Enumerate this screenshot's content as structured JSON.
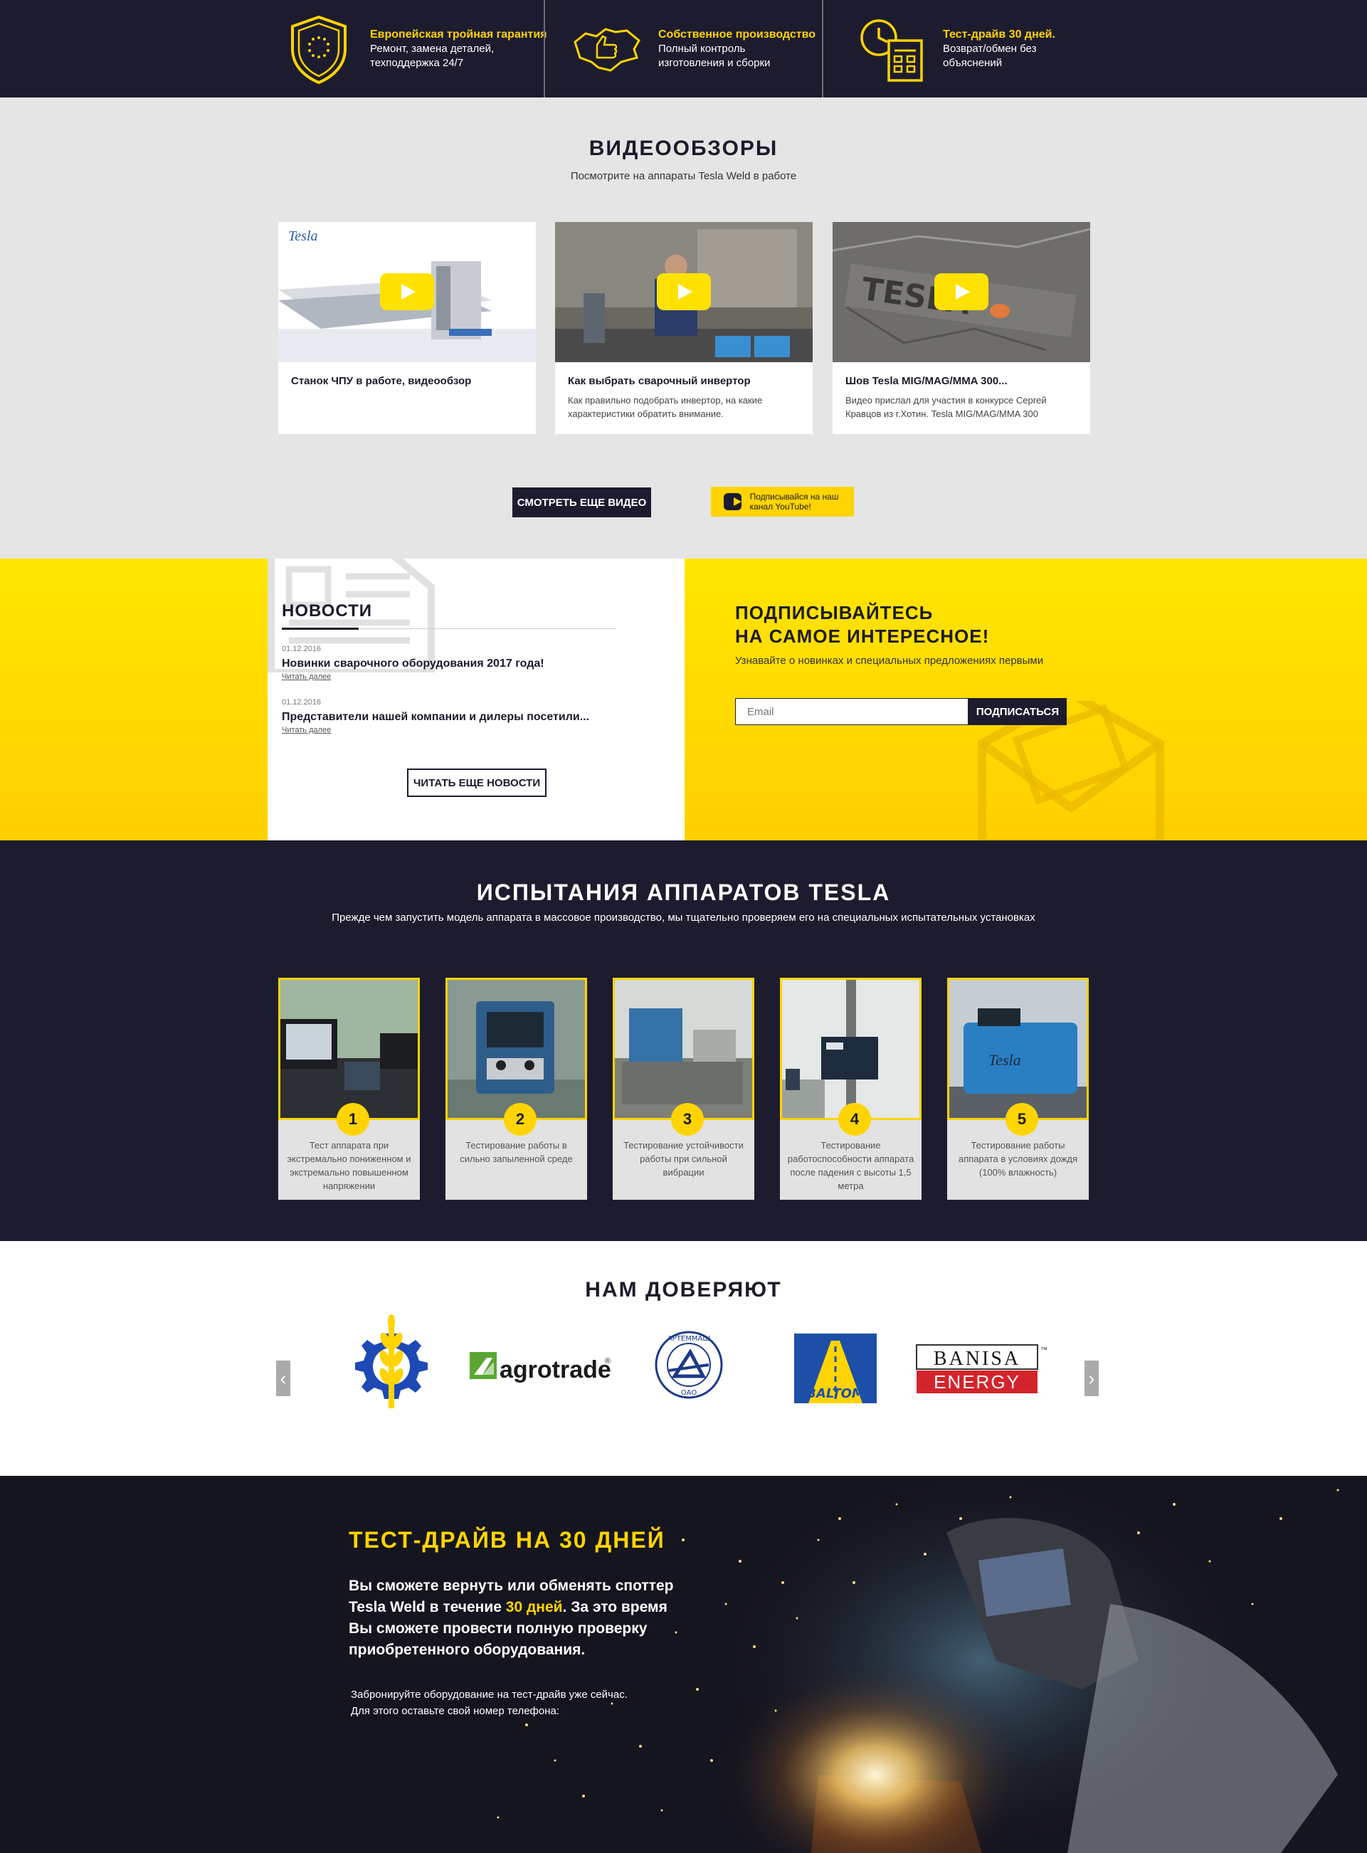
{
  "features": [
    {
      "icon": "eu-shield-icon",
      "title": "Европейская тройная гарантия",
      "desc": "Ремонт, замена деталей, техподдержка 24/7"
    },
    {
      "icon": "ukraine-map-thumb-icon",
      "title": "Собственное производство",
      "desc": "Полный контроль изготовления и сборки"
    },
    {
      "icon": "clock-calendar-icon",
      "title": "Тест-драйв 30 дней.",
      "desc": "Возврат/обмен без объяснений"
    }
  ],
  "videos": {
    "title": "ВИДЕООБЗОРЫ",
    "subtitle": "Посмотрите на аппараты Tesla Weld в работе",
    "items": [
      {
        "title": "Станок ЧПУ в работе, видеообзор",
        "desc": ""
      },
      {
        "title": "Как выбрать сварочный инвертор",
        "desc": "Как правильно подобрать инвертор, на какие характеристики обратить внимание."
      },
      {
        "title": "Шов Tesla MIG/MAG/MMA 300...",
        "desc": "Видео прислал для участия в конкурсе Сергей Кравцов из г.Хотин. Tesla MIG/MAG/MMA 300"
      }
    ],
    "more_label": "СМОТРЕТЬ ЕЩЕ ВИДЕО",
    "subscribe_yt": "Подписывайся на наш канал YouTube!"
  },
  "news": {
    "title": "НОВОСТИ",
    "items": [
      {
        "date": "01.12.2016",
        "headline": "Новинки сварочного оборудования 2017 года!",
        "more": "Читать далее"
      },
      {
        "date": "01.12.2016",
        "headline": "Представители нашей компании и дилеры посетили...",
        "more": "Читать далее"
      }
    ],
    "more_label": "ЧИТАТЬ ЕЩЕ НОВОСТИ"
  },
  "subscribe": {
    "title_line1": "ПОДПИСЫВАЙТЕСЬ",
    "title_line2": "НА САМОЕ ИНТЕРЕСНОЕ!",
    "desc": "Узнавайте о новинках и специальных предложениях первыми",
    "placeholder": "Email",
    "button": "ПОДПИСАТЬСЯ"
  },
  "tests": {
    "title": "ИСПЫТАНИЯ АППАРАТОВ TESLA",
    "subtitle": "Прежде чем запустить модель аппарата в массовое производство, мы тщательно проверяем его на специальных испытательных установках",
    "items": [
      {
        "num": "1",
        "desc": "Тест аппарата при экстремально пониженном и экстремально повышенном напряжении"
      },
      {
        "num": "2",
        "desc": "Тестирование работы в сильно запыленной среде"
      },
      {
        "num": "3",
        "desc": "Тестирование устойчивости работы при сильной вибрации"
      },
      {
        "num": "4",
        "desc": "Тестирование работоспособности аппарата после падения с высоты 1,5 метра"
      },
      {
        "num": "5",
        "desc": "Тестирование работы аппарата в условиях дождя (100% влажность)"
      }
    ]
  },
  "trust": {
    "title": "НАМ ДОВЕРЯЮТ",
    "logos": [
      "agro-gear-logo",
      "agrotrade",
      "АРТЕММАШ ОАО",
      "BALTOM",
      "BANISA ENERGY"
    ],
    "agrotrade_text": "agrotrade",
    "artemmash_top": "АРТЕММАШ",
    "artemmash_bottom": "ОАО",
    "baltom_text": "BALTOM",
    "banisa_line1": "BANISA",
    "banisa_line2": "ENERGY",
    "tm": "™",
    "reg": "®"
  },
  "drive": {
    "title": "ТЕСТ-ДРАЙВ НА 30 ДНЕЙ",
    "text_a": "Вы сможете вернуть или обменять споттер Tesla Weld в течение ",
    "text_hl": "30 дней",
    "text_b": ". За это время Вы сможете провести полную проверку приобретенного оборудования.",
    "note": "Забронируйте оборудование на тест-драйв уже сейчас. Для этого оставьте свой номер телефона:"
  },
  "colors": {
    "dark": "#1d1c2f",
    "accent": "#ffd400",
    "light": "#e5e5e5"
  }
}
